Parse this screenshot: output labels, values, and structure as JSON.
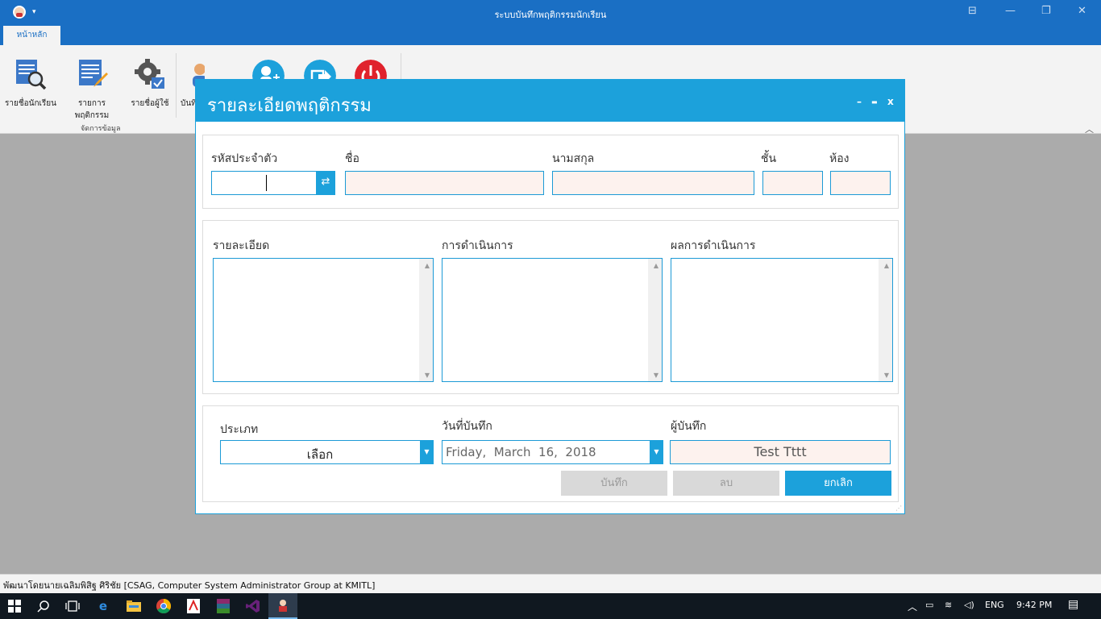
{
  "app": {
    "title": "ระบบบันทึกพฤติกรรมนักเรียน",
    "quick_access_dropdown": "▾",
    "window_controls": {
      "ribbon_display": "⊟",
      "minimize": "—",
      "restore": "❐",
      "close": "✕"
    }
  },
  "tabs": [
    {
      "label": "หน้าหลัก"
    }
  ],
  "ribbon": {
    "groups": [
      {
        "label": "จัดการข้อมูล"
      }
    ],
    "buttons": [
      {
        "label": "รายชื่อนักเรียน",
        "icon": "student-list-search-icon"
      },
      {
        "label": "รายการพฤติกรรม",
        "icon": "behavior-list-edit-icon"
      },
      {
        "label": "รายชื่อผู้ใช้",
        "icon": "user-settings-gear-icon"
      },
      {
        "label": "บันทึก",
        "icon": "users-icon"
      }
    ],
    "collapse_glyph": "︿"
  },
  "dialog": {
    "title": "รายละเอียดพฤติกรรม",
    "controls": {
      "minimize": "–",
      "maximize": "▬",
      "close": "x"
    },
    "student": {
      "id_label": "รหัสประจำตัว",
      "id_value": "",
      "first_name_label": "ชื่อ",
      "first_name_value": "",
      "last_name_label": "นามสกุล",
      "last_name_value": "",
      "grade_label": "ชั้น",
      "grade_value": "",
      "room_label": "ห้อง",
      "room_value": ""
    },
    "details": {
      "detail_label": "รายละเอียด",
      "action_label": "การดำเนินการ",
      "result_label": "ผลการดำเนินการ"
    },
    "meta": {
      "type_label": "ประเภท",
      "type_value": "เลือก",
      "date_label": "วันที่บันทึก",
      "date_value": "Friday,  March  16,  2018",
      "recorder_label": "ผู้บันทึก",
      "recorder_value": "Test Tttt"
    },
    "buttons": {
      "save": "บันทึก",
      "delete": "ลบ",
      "cancel": "ยกเลิก"
    }
  },
  "statusbar": {
    "text": "พัฒนาโดยนายเฉลิมพิสิฐ ศิริชัย [CSAG, Computer System Administrator Group at KMITL]"
  },
  "taskbar": {
    "language": "ENG",
    "time": "9:42 PM"
  }
}
